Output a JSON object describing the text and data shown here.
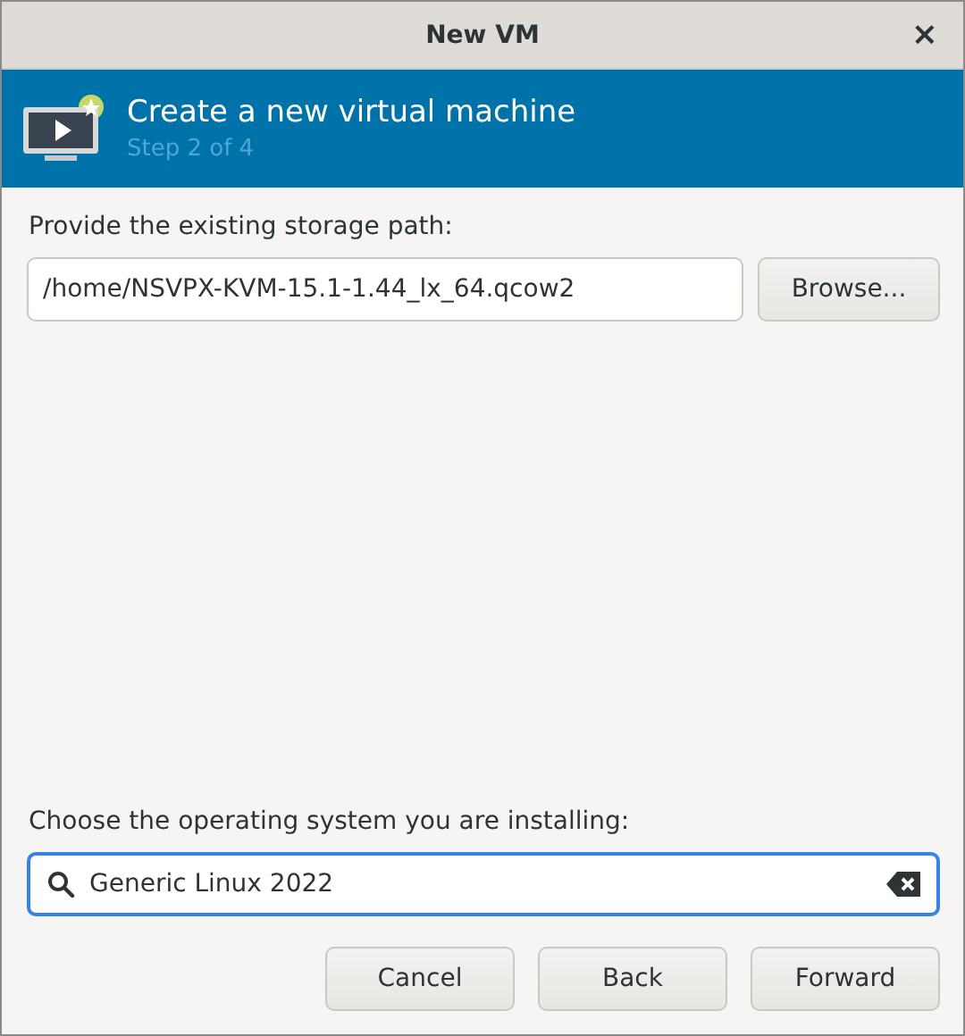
{
  "window": {
    "title": "New VM",
    "close": "×"
  },
  "header": {
    "title": "Create a new virtual machine",
    "subtitle": "Step 2 of 4"
  },
  "storage": {
    "label": "Provide the existing storage path:",
    "value": "/home/NSVPX-KVM-15.1-1.44_lx_64.qcow2",
    "browse": "Browse..."
  },
  "os": {
    "label": "Choose the operating system you are installing:",
    "value": "Generic Linux 2022"
  },
  "buttons": [
    "Cancel",
    "Back",
    "Forward"
  ]
}
